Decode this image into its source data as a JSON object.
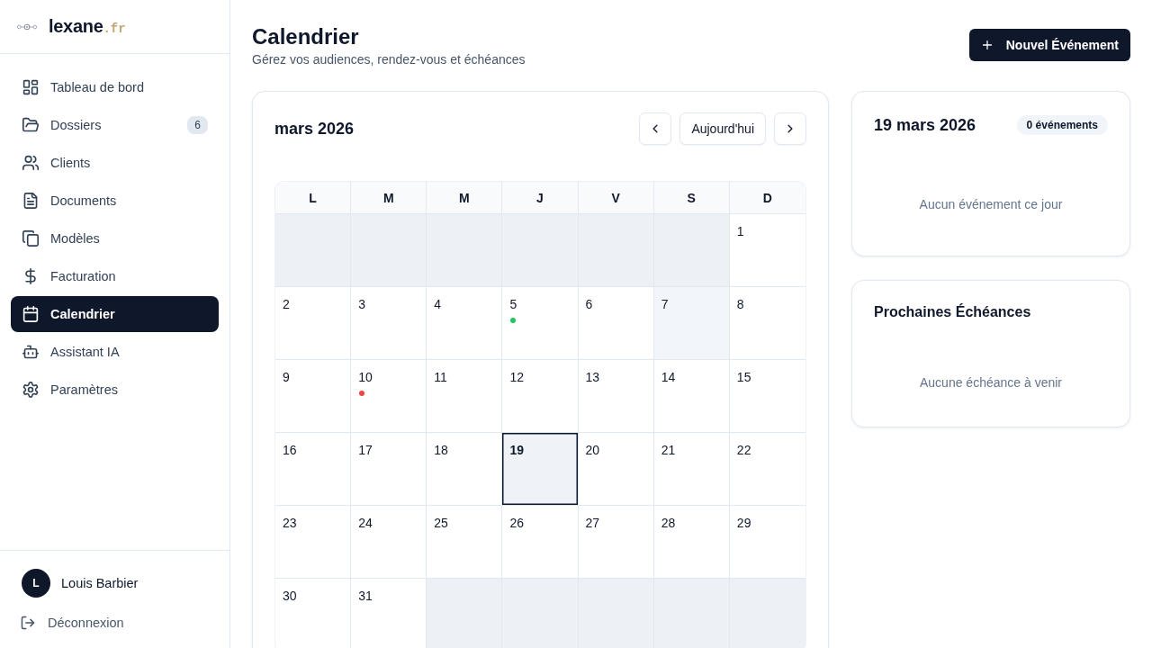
{
  "sidebar": {
    "logo": {
      "name": "lexane",
      "domain": ".fr"
    },
    "items": [
      {
        "label": "Tableau de bord",
        "selected": false
      },
      {
        "label": "Dossiers",
        "selected": false,
        "badge": "6"
      },
      {
        "label": "Clients",
        "selected": false
      },
      {
        "label": "Documents",
        "selected": false
      },
      {
        "label": "Modèles",
        "selected": false
      },
      {
        "label": "Facturation",
        "selected": false
      },
      {
        "label": "Calendrier",
        "selected": true
      },
      {
        "label": "Assistant IA",
        "selected": false
      },
      {
        "label": "Paramètres",
        "selected": false
      }
    ],
    "user": {
      "initial": "L",
      "name": "Louis Barbier"
    },
    "logout": "Déconnexion"
  },
  "header": {
    "title": "Calendrier",
    "subtitle": "Gérez vos audiences, rendez-vous et échéances",
    "new_event_button": "Nouvel Événement"
  },
  "calendar": {
    "month": "mars 2026",
    "today_button": "Aujourd'hui",
    "weekdays": [
      "L",
      "M",
      "M",
      "J",
      "V",
      "S",
      "D"
    ],
    "cells": [
      {
        "kind": "blank"
      },
      {
        "kind": "blank"
      },
      {
        "kind": "blank"
      },
      {
        "kind": "blank"
      },
      {
        "kind": "blank"
      },
      {
        "kind": "blank"
      },
      {
        "kind": "day",
        "day": "1",
        "selected": false,
        "hovered": false
      },
      {
        "kind": "day",
        "day": "2",
        "selected": false,
        "hovered": false
      },
      {
        "kind": "day",
        "day": "3",
        "selected": false,
        "hovered": false
      },
      {
        "kind": "day",
        "day": "4",
        "selected": false,
        "hovered": false
      },
      {
        "kind": "day",
        "day": "5",
        "selected": false,
        "hovered": false,
        "events": [
          {
            "color": "#22c55e"
          }
        ]
      },
      {
        "kind": "day",
        "day": "6",
        "selected": false,
        "hovered": false
      },
      {
        "kind": "day",
        "day": "7",
        "selected": false,
        "hovered": true
      },
      {
        "kind": "day",
        "day": "8",
        "selected": false,
        "hovered": false
      },
      {
        "kind": "day",
        "day": "9",
        "selected": false,
        "hovered": false
      },
      {
        "kind": "day",
        "day": "10",
        "selected": false,
        "hovered": false,
        "events": [
          {
            "color": "#ef4444"
          }
        ]
      },
      {
        "kind": "day",
        "day": "11",
        "selected": false,
        "hovered": false
      },
      {
        "kind": "day",
        "day": "12",
        "selected": false,
        "hovered": false
      },
      {
        "kind": "day",
        "day": "13",
        "selected": false,
        "hovered": false
      },
      {
        "kind": "day",
        "day": "14",
        "selected": false,
        "hovered": false
      },
      {
        "kind": "day",
        "day": "15",
        "selected": false,
        "hovered": false
      },
      {
        "kind": "day",
        "day": "16",
        "selected": false,
        "hovered": false
      },
      {
        "kind": "day",
        "day": "17",
        "selected": false,
        "hovered": false
      },
      {
        "kind": "day",
        "day": "18",
        "selected": false,
        "hovered": false
      },
      {
        "kind": "day",
        "day": "19",
        "selected": true,
        "hovered": false
      },
      {
        "kind": "day",
        "day": "20",
        "selected": false,
        "hovered": false
      },
      {
        "kind": "day",
        "day": "21",
        "selected": false,
        "hovered": false
      },
      {
        "kind": "day",
        "day": "22",
        "selected": false,
        "hovered": false
      },
      {
        "kind": "day",
        "day": "23",
        "selected": false,
        "hovered": false
      },
      {
        "kind": "day",
        "day": "24",
        "selected": false,
        "hovered": false
      },
      {
        "kind": "day",
        "day": "25",
        "selected": false,
        "hovered": false
      },
      {
        "kind": "day",
        "day": "26",
        "selected": false,
        "hovered": false
      },
      {
        "kind": "day",
        "day": "27",
        "selected": false,
        "hovered": false
      },
      {
        "kind": "day",
        "day": "28",
        "selected": false,
        "hovered": false
      },
      {
        "kind": "day",
        "day": "29",
        "selected": false,
        "hovered": false
      },
      {
        "kind": "day",
        "day": "30",
        "selected": false,
        "hovered": false
      },
      {
        "kind": "day",
        "day": "31",
        "selected": false,
        "hovered": false
      },
      {
        "kind": "blank"
      },
      {
        "kind": "blank"
      },
      {
        "kind": "blank"
      },
      {
        "kind": "blank"
      },
      {
        "kind": "blank"
      }
    ]
  },
  "day_panel": {
    "date": "19 mars 2026",
    "count": "0 événements",
    "empty_message": "Aucun événement ce jour"
  },
  "deadlines": {
    "title": "Prochaines Échéances",
    "empty_message": "Aucune échéance à venir"
  }
}
